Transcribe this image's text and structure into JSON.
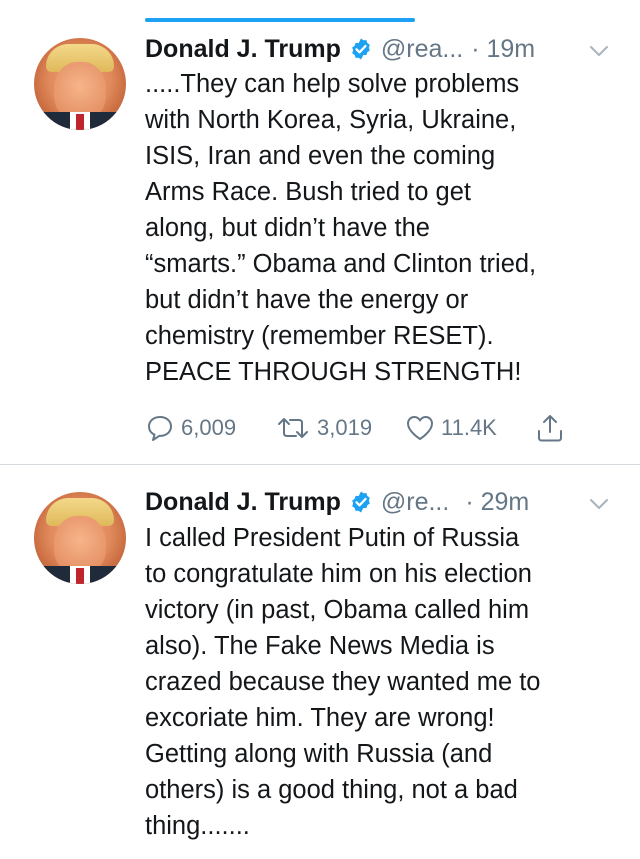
{
  "tweets": [
    {
      "name": "Donald J. Trump",
      "handle": "@rea...",
      "time": "· 19m",
      "lines": [
        ".....They can help solve problems",
        "with North Korea, Syria, Ukraine,",
        "ISIS, Iran and even the coming",
        "Arms Race. Bush tried to get",
        "along, but didn’t have the",
        "“smarts.” Obama and Clinton tried,",
        "but didn’t have the energy or",
        "chemistry (remember RESET).",
        "PEACE THROUGH STRENGTH!"
      ],
      "replies": "6,009",
      "retweets": "3,019",
      "likes": "11.4K"
    },
    {
      "name": "Donald J. Trump",
      "handle": "@re...",
      "time": "· 29m",
      "lines": [
        "I called President Putin of Russia",
        "to congratulate him on his election",
        "victory (in past, Obama called him",
        "also). The Fake News Media is",
        "crazed because they wanted me to",
        "excoriate him. They are wrong!",
        "Getting along with Russia (and",
        "others) is a good thing, not a bad",
        "thing......."
      ]
    }
  ],
  "icons": {
    "verified": "verified-badge-icon",
    "chevron": "chevron-down-icon",
    "reply": "reply-icon",
    "retweet": "retweet-icon",
    "like": "heart-icon",
    "share": "share-icon"
  },
  "colors": {
    "accent": "#1da1f2",
    "secondary_text": "#657786",
    "text": "#14171a"
  }
}
